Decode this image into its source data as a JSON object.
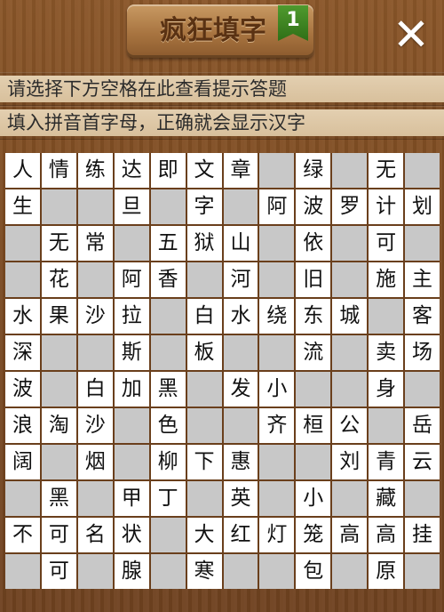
{
  "header": {
    "title": "疯狂填字",
    "level": "1",
    "close_label": "✕"
  },
  "hints": {
    "line1": "请选择下方空格在此查看提示答题",
    "line2": "填入拼音首字母，正确就会显示汉字"
  },
  "board": {
    "rows": [
      [
        "人",
        "情",
        "练",
        "达",
        "即",
        "文",
        "章",
        "#",
        "绿",
        "#",
        "无",
        "#"
      ],
      [
        "生",
        "#",
        "#",
        "旦",
        "#",
        "字",
        "#",
        "阿",
        "波",
        "罗",
        "计",
        "划"
      ],
      [
        "#",
        "无",
        "常",
        "#",
        "五",
        "狱",
        "山",
        "#",
        "依",
        "#",
        "可",
        "#"
      ],
      [
        "#",
        "花",
        "#",
        "阿",
        "香",
        "#",
        "河",
        "#",
        "旧",
        "#",
        "施",
        "主"
      ],
      [
        "水",
        "果",
        "沙",
        "拉",
        "#",
        "白",
        "水",
        "绕",
        "东",
        "城",
        "#",
        "客"
      ],
      [
        "深",
        "#",
        "#",
        "斯",
        "#",
        "板",
        "#",
        "#",
        "流",
        "#",
        "卖",
        "场"
      ],
      [
        "波",
        "#",
        "白",
        "加",
        "黑",
        "#",
        "发",
        "小",
        "#",
        "#",
        "身",
        "#"
      ],
      [
        "浪",
        "淘",
        "沙",
        "#",
        "色",
        "#",
        "#",
        "齐",
        "桓",
        "公",
        "#",
        "岳"
      ],
      [
        "阔",
        "#",
        "烟",
        "#",
        "柳",
        "下",
        "惠",
        "#",
        "#",
        "刘",
        "青",
        "云"
      ],
      [
        "#",
        "黑",
        "#",
        "甲",
        "丁",
        "#",
        "英",
        "#",
        "小",
        "#",
        "藏",
        "#"
      ],
      [
        "不",
        "可",
        "名",
        "状",
        "#",
        "大",
        "红",
        "灯",
        "笼",
        "高",
        "高",
        "挂"
      ],
      [
        "#",
        "可",
        "#",
        "腺",
        "#",
        "寒",
        "#",
        "#",
        "包",
        "#",
        "原",
        "#"
      ]
    ]
  }
}
